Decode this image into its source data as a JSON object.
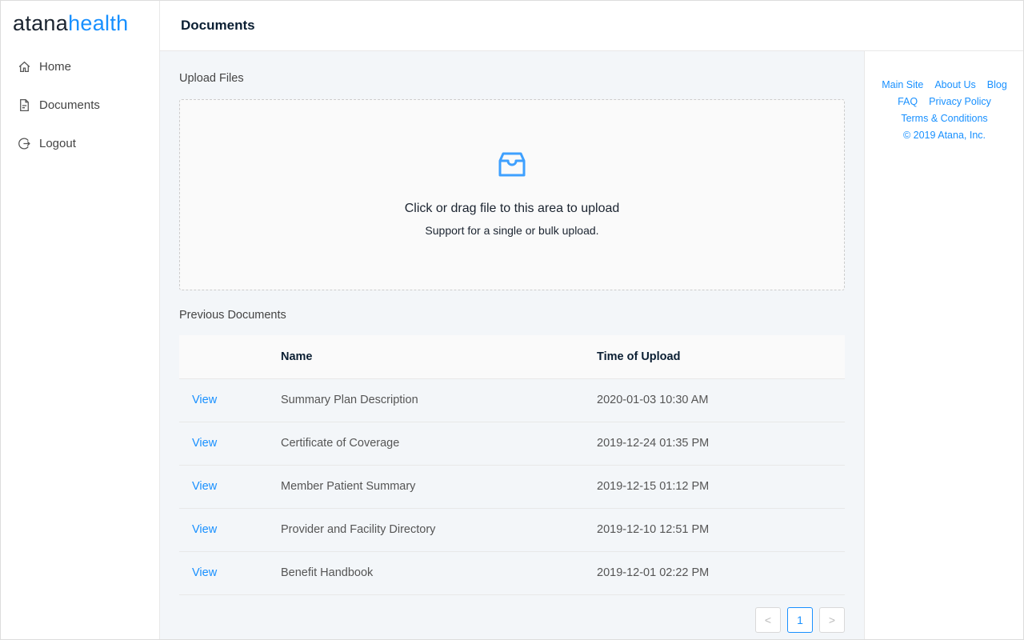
{
  "brand": {
    "part1": "atana",
    "part2": "health"
  },
  "nav": [
    {
      "label": "Home",
      "icon": "home-icon"
    },
    {
      "label": "Documents",
      "icon": "file-icon"
    },
    {
      "label": "Logout",
      "icon": "logout-icon"
    }
  ],
  "header": {
    "title": "Documents"
  },
  "upload": {
    "title": "Upload Files",
    "text": "Click or drag file to this area to upload",
    "hint": "Support for a single or bulk upload."
  },
  "previous": {
    "title": "Previous Documents",
    "columns": [
      "",
      "Name",
      "Time of Upload"
    ],
    "rows": [
      {
        "action": "View",
        "name": "Summary Plan Description",
        "time": "2020-01-03 10:30 AM"
      },
      {
        "action": "View",
        "name": "Certificate of Coverage",
        "time": "2019-12-24 01:35 PM"
      },
      {
        "action": "View",
        "name": "Member Patient Summary",
        "time": "2019-12-15 01:12 PM"
      },
      {
        "action": "View",
        "name": "Provider and Facility Directory",
        "time": "2019-12-10 12:51 PM"
      },
      {
        "action": "View",
        "name": "Benefit Handbook",
        "time": "2019-12-01 02:22 PM"
      }
    ]
  },
  "pagination": {
    "prev": "<",
    "current": "1",
    "next": ">"
  },
  "footer": {
    "links": [
      "Main Site",
      "About Us",
      "Blog",
      "FAQ",
      "Privacy Policy",
      "Terms & Conditions"
    ],
    "copyright": "© 2019 Atana, Inc."
  },
  "colors": {
    "accent": "#1890ff"
  }
}
